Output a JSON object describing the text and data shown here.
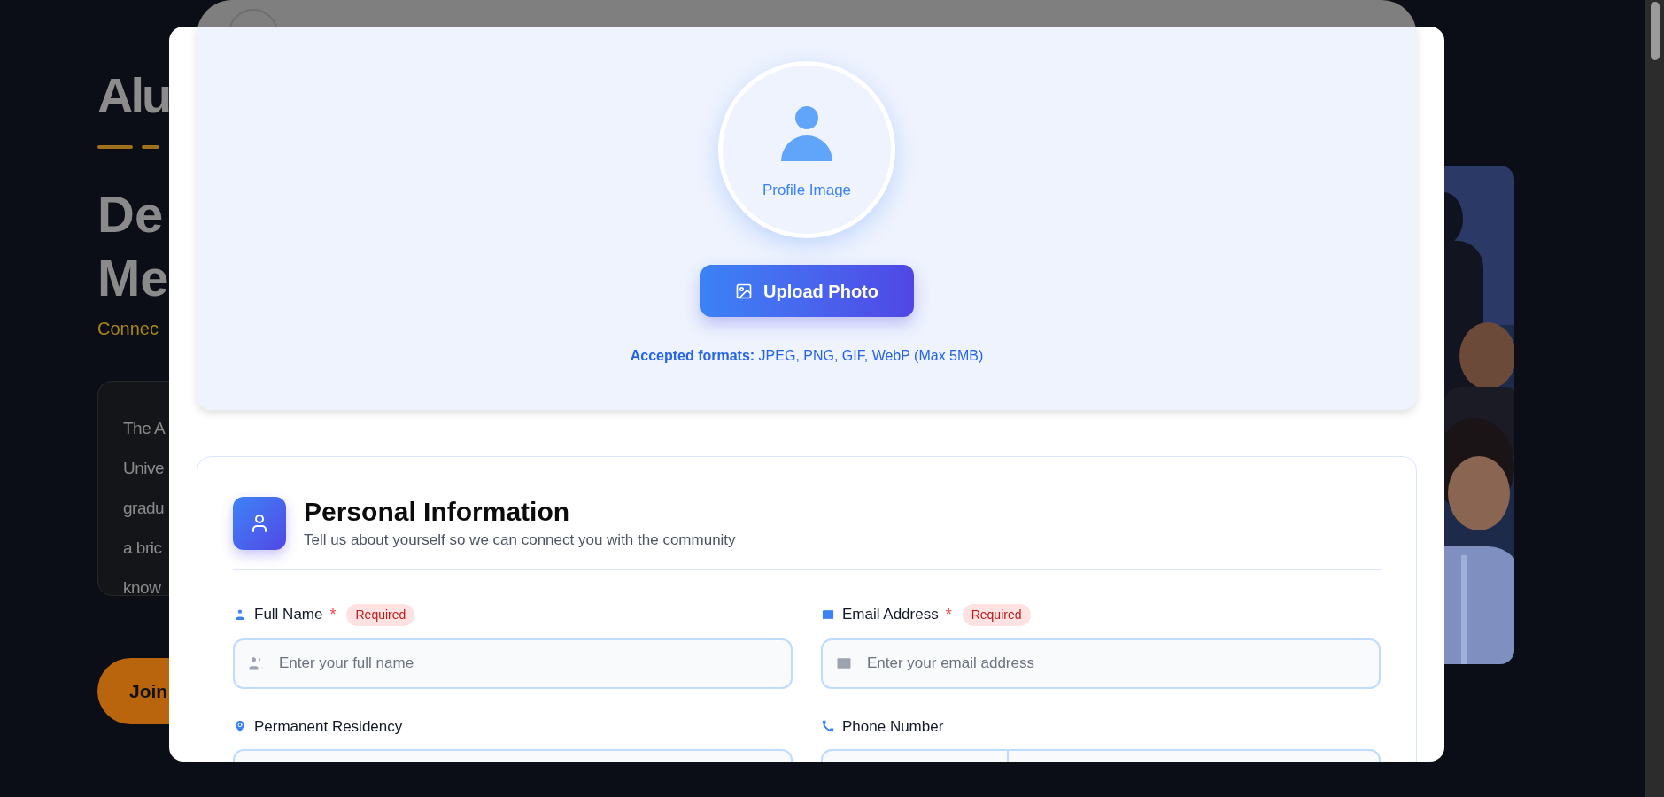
{
  "background_page": {
    "heading": "Alu",
    "subheading_lines": [
      "De",
      "Me"
    ],
    "tagline": "Connec",
    "intro_lines": [
      "The A",
      "Unive",
      "gradu",
      "a bric",
      "know"
    ],
    "join_button": "Join"
  },
  "modal": {
    "upload": {
      "avatar_label": "Profile Image",
      "button": "Upload Photo",
      "formats": "**Accepted formats:** JPEG, PNG, GIF, WebP (Max 5MB)"
    },
    "personal_info": {
      "title": "Personal Information",
      "subtitle": "Tell us about yourself so we can connect you with the community",
      "fields": [
        {
          "kind": "text",
          "label": "Full Name",
          "required_mark": "*",
          "badge": "Required",
          "placeholder": "Enter your full name"
        },
        {
          "kind": "text",
          "label": "Email Address",
          "required_mark": "*",
          "badge": "Required",
          "placeholder": "Enter your email address"
        },
        {
          "kind": "text",
          "label": "Permanent Residency"
        },
        {
          "kind": "phone",
          "label": "Phone Number"
        }
      ]
    }
  }
}
